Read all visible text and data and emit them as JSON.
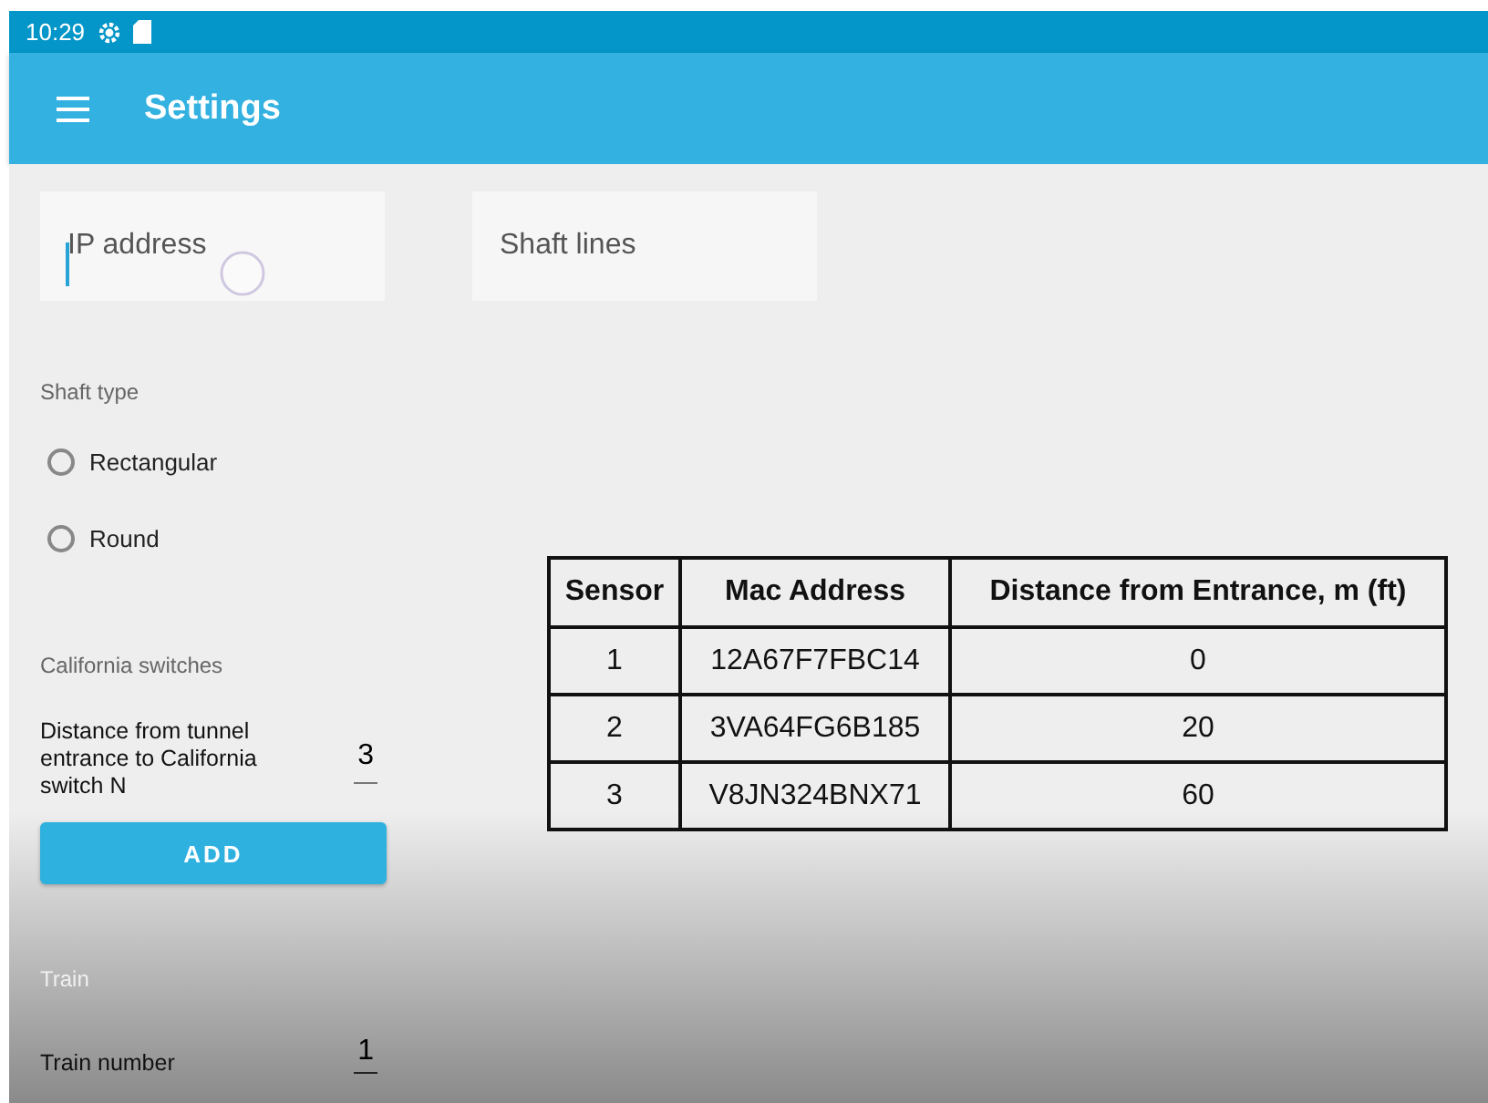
{
  "status_bar": {
    "time": "10:29"
  },
  "app_bar": {
    "title": "Settings"
  },
  "fields": [
    {
      "placeholder": "IP address",
      "focused": true
    },
    {
      "placeholder": "Shaft lines",
      "focused": false
    }
  ],
  "shaft_type": {
    "heading": "Shaft type",
    "options": [
      {
        "label": "Rectangular",
        "selected": false
      },
      {
        "label": "Round",
        "selected": false
      }
    ]
  },
  "california_switches": {
    "heading": "California switches",
    "label": "Distance from tunnel entrance to California switch N",
    "value": "3",
    "button": "ADD"
  },
  "train": {
    "heading": "Train",
    "label": "Train number",
    "value": "1"
  },
  "table": {
    "columns": [
      "Sensor",
      "Mac Address",
      "Distance from Entrance, m (ft)"
    ],
    "rows": [
      [
        "1",
        "12A67F7FBC14",
        "0"
      ],
      [
        "2",
        "3VA64FG6B185",
        "20"
      ],
      [
        "3",
        "V8JN324BNX71",
        "60"
      ]
    ]
  }
}
